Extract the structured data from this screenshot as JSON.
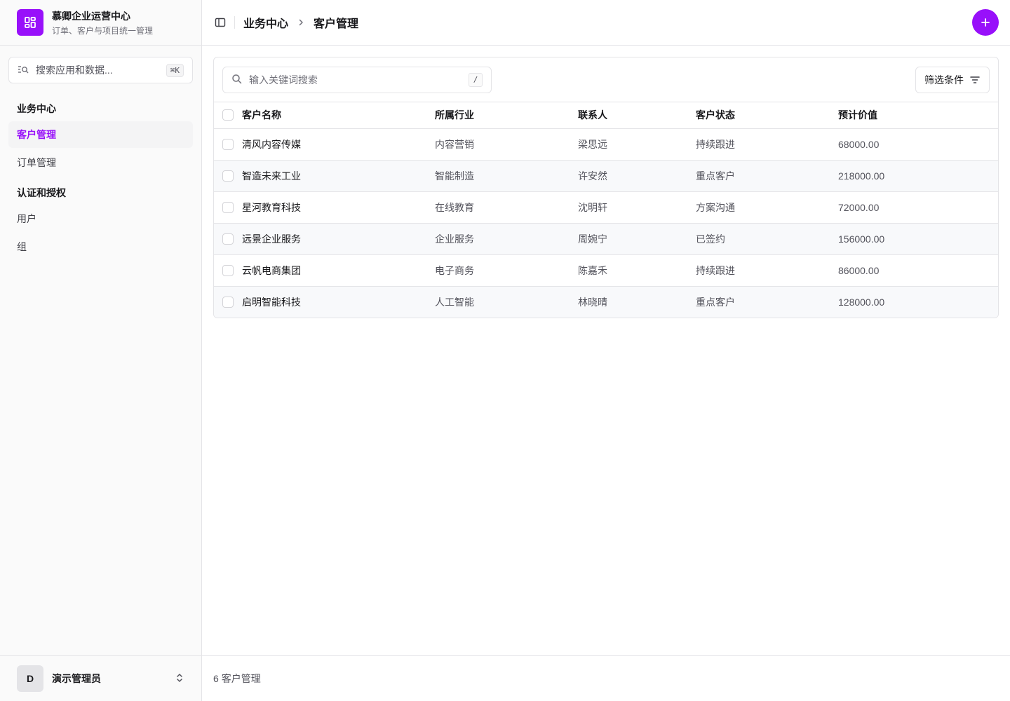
{
  "brand": {
    "title": "慕卿企业运营中心",
    "subtitle": "订单、客户与项目统一管理",
    "accent": "#9810fa"
  },
  "sidebar": {
    "search_placeholder": "搜索应用和数据...",
    "search_shortcut": "⌘K",
    "groups": [
      {
        "title": "业务中心",
        "items": [
          {
            "label": "客户管理",
            "active": true
          },
          {
            "label": "订单管理",
            "active": false
          }
        ]
      },
      {
        "title": "认证和授权",
        "items": [
          {
            "label": "用户",
            "active": false
          },
          {
            "label": "组",
            "active": false
          }
        ]
      }
    ],
    "user": {
      "initial": "D",
      "name": "演示管理员"
    }
  },
  "header": {
    "breadcrumb": [
      "业务中心",
      "客户管理"
    ]
  },
  "toolbar": {
    "search_placeholder": "输入关键词搜索",
    "search_shortcut": "/",
    "filter_label": "筛选条件"
  },
  "table": {
    "columns": [
      "客户名称",
      "所属行业",
      "联系人",
      "客户状态",
      "预计价值"
    ],
    "rows": [
      [
        "清风内容传媒",
        "内容营销",
        "梁思远",
        "持续跟进",
        "68000.00"
      ],
      [
        "智造未来工业",
        "智能制造",
        "许安然",
        "重点客户",
        "218000.00"
      ],
      [
        "星河教育科技",
        "在线教育",
        "沈明轩",
        "方案沟通",
        "72000.00"
      ],
      [
        "远景企业服务",
        "企业服务",
        "周婉宁",
        "已签约",
        "156000.00"
      ],
      [
        "云帆电商集团",
        "电子商务",
        "陈嘉禾",
        "持续跟进",
        "86000.00"
      ],
      [
        "启明智能科技",
        "人工智能",
        "林晓晴",
        "重点客户",
        "128000.00"
      ]
    ]
  },
  "footer": {
    "count": "6",
    "label": "客户管理"
  }
}
